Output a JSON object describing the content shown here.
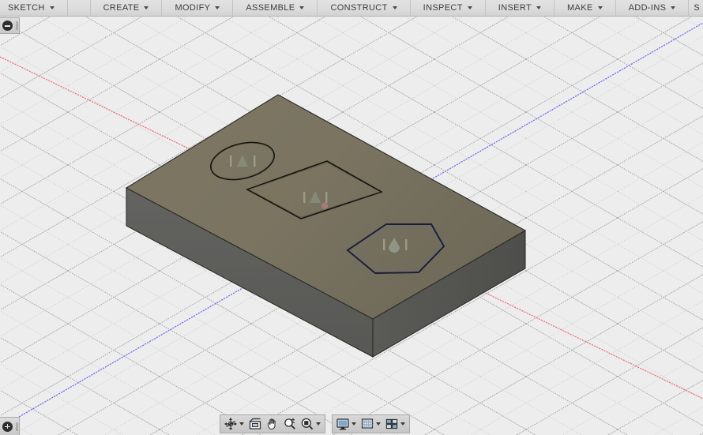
{
  "app": {
    "name": "Fusion 360 CAD viewport",
    "background_color": "#ededed",
    "grid_line_color": "#9a9a9a"
  },
  "toolbar": {
    "items": [
      {
        "label": "SKETCH",
        "name": "sketch",
        "has_caret": true
      },
      {
        "label": "CREATE",
        "name": "create",
        "has_caret": true
      },
      {
        "label": "MODIFY",
        "name": "modify",
        "has_caret": true
      },
      {
        "label": "ASSEMBLE",
        "name": "assemble",
        "has_caret": true
      },
      {
        "label": "CONSTRUCT",
        "name": "construct",
        "has_caret": true
      },
      {
        "label": "INSPECT",
        "name": "inspect",
        "has_caret": true
      },
      {
        "label": "INSERT",
        "name": "insert",
        "has_caret": true
      },
      {
        "label": "MAKE",
        "name": "make",
        "has_caret": true
      },
      {
        "label": "ADD-INS",
        "name": "add-ins",
        "has_caret": true
      },
      {
        "label": "S",
        "name": "select",
        "has_caret": false
      }
    ]
  },
  "browser_panel": {
    "collapse_icon": "minus-circle-icon",
    "expand_icon": "plus-circle-icon"
  },
  "navigation_bar": {
    "groups": [
      {
        "name": "view-tools",
        "buttons": [
          {
            "name": "orbit",
            "icon": "orbit-icon",
            "caret": true
          },
          {
            "name": "look-at",
            "icon": "look-at-icon",
            "caret": false
          },
          {
            "name": "pan",
            "icon": "pan-hand-icon",
            "caret": false
          },
          {
            "name": "zoom",
            "icon": "zoom-icon",
            "caret": false
          },
          {
            "name": "fit",
            "icon": "zoom-fit-icon",
            "caret": true
          }
        ]
      },
      {
        "name": "display-tools",
        "buttons": [
          {
            "name": "display-settings",
            "icon": "monitor-icon",
            "caret": true
          },
          {
            "name": "grid-and-snaps",
            "icon": "grid-icon",
            "caret": true
          },
          {
            "name": "viewport-layout",
            "icon": "viewports-icon",
            "caret": true
          }
        ]
      }
    ]
  },
  "scene": {
    "axes": [
      {
        "name": "x-axis",
        "color": "#e8737a"
      },
      {
        "name": "y-axis",
        "color": "#6c6cf0"
      }
    ],
    "body": {
      "name": "rectangular-slab",
      "top_face_color": "#78725f",
      "left_face_color": "#5b5b58",
      "front_face_color": "#565652",
      "edge_color": "#2a2a26"
    },
    "sketch_profiles": [
      {
        "name": "ellipse-profile",
        "shape": "ellipse",
        "edge_color": "#1a1a18",
        "selected": false
      },
      {
        "name": "rectangle-profile",
        "shape": "rectangle",
        "edge_color": "#1a1a18",
        "selected": false
      },
      {
        "name": "hexagon-profile",
        "shape": "hexagon",
        "edge_color": "#26263c",
        "selected": true
      }
    ],
    "markers": [
      {
        "name": "ellipse-center-marker",
        "glyph": "sketch-point-icon"
      },
      {
        "name": "rectangle-center-marker",
        "glyph": "sketch-point-icon"
      },
      {
        "name": "hexagon-center-marker",
        "glyph": "sketch-point-icon"
      },
      {
        "name": "origin-point-marker",
        "glyph": "origin-dot-icon",
        "color": "#c08892"
      }
    ]
  }
}
